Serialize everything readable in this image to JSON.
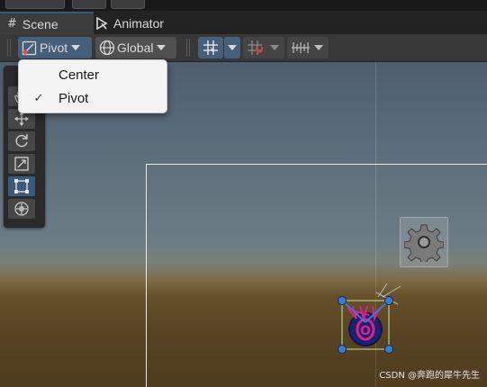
{
  "tabs": [
    {
      "label": "Scene",
      "icon": "grid-hash-icon",
      "active": true
    },
    {
      "label": "Animator",
      "icon": "animator-icon",
      "active": false
    }
  ],
  "toolbar": {
    "pivot_label": "Pivot",
    "global_label": "Global"
  },
  "pivot_menu": {
    "items": [
      {
        "label": "Center",
        "checked": false
      },
      {
        "label": "Pivot",
        "checked": true
      }
    ]
  },
  "tools": [
    {
      "name": "view-tool",
      "active": false
    },
    {
      "name": "move-tool",
      "active": false
    },
    {
      "name": "rotate-tool",
      "active": false
    },
    {
      "name": "scale-tool",
      "active": false
    },
    {
      "name": "rect-tool",
      "active": true
    },
    {
      "name": "transform-tool",
      "active": false
    }
  ],
  "watermark": "CSDN @奔跑的犀牛先生",
  "colors": {
    "accent_blue": "#46607c",
    "selection_handle": "#3a7bd5",
    "sprite_pink": "#e0208a"
  }
}
